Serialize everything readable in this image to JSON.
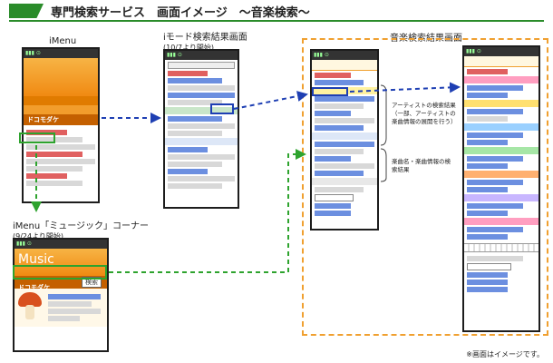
{
  "title": "専門検索サービス　画面イメージ　～音楽検索～",
  "captions": {
    "imenu": "iMenu",
    "imode_search": "iモード検索結果画面",
    "imode_search_sub": "(10/7より開始)",
    "music_search": "音楽検索結果画面",
    "music_corner": "iMenu「ミュージック」コーナー",
    "music_corner_sub": "(9/24より開始)"
  },
  "search_box_text": "ドコモダケ",
  "search_button": "検索",
  "music_logo": "Music",
  "notes": {
    "artist": "アーティストの検索結果（一部、アーティストの楽曲情報の展開を行う）",
    "song": "楽曲名・楽曲情報の検索結果"
  },
  "footnote": "※画面はイメージです。",
  "colors": {
    "accent_green": "#2a8c2a",
    "highlight_green": "#2ea32e",
    "highlight_blue": "#1e3fb3",
    "frame_orange": "#f0a030"
  }
}
